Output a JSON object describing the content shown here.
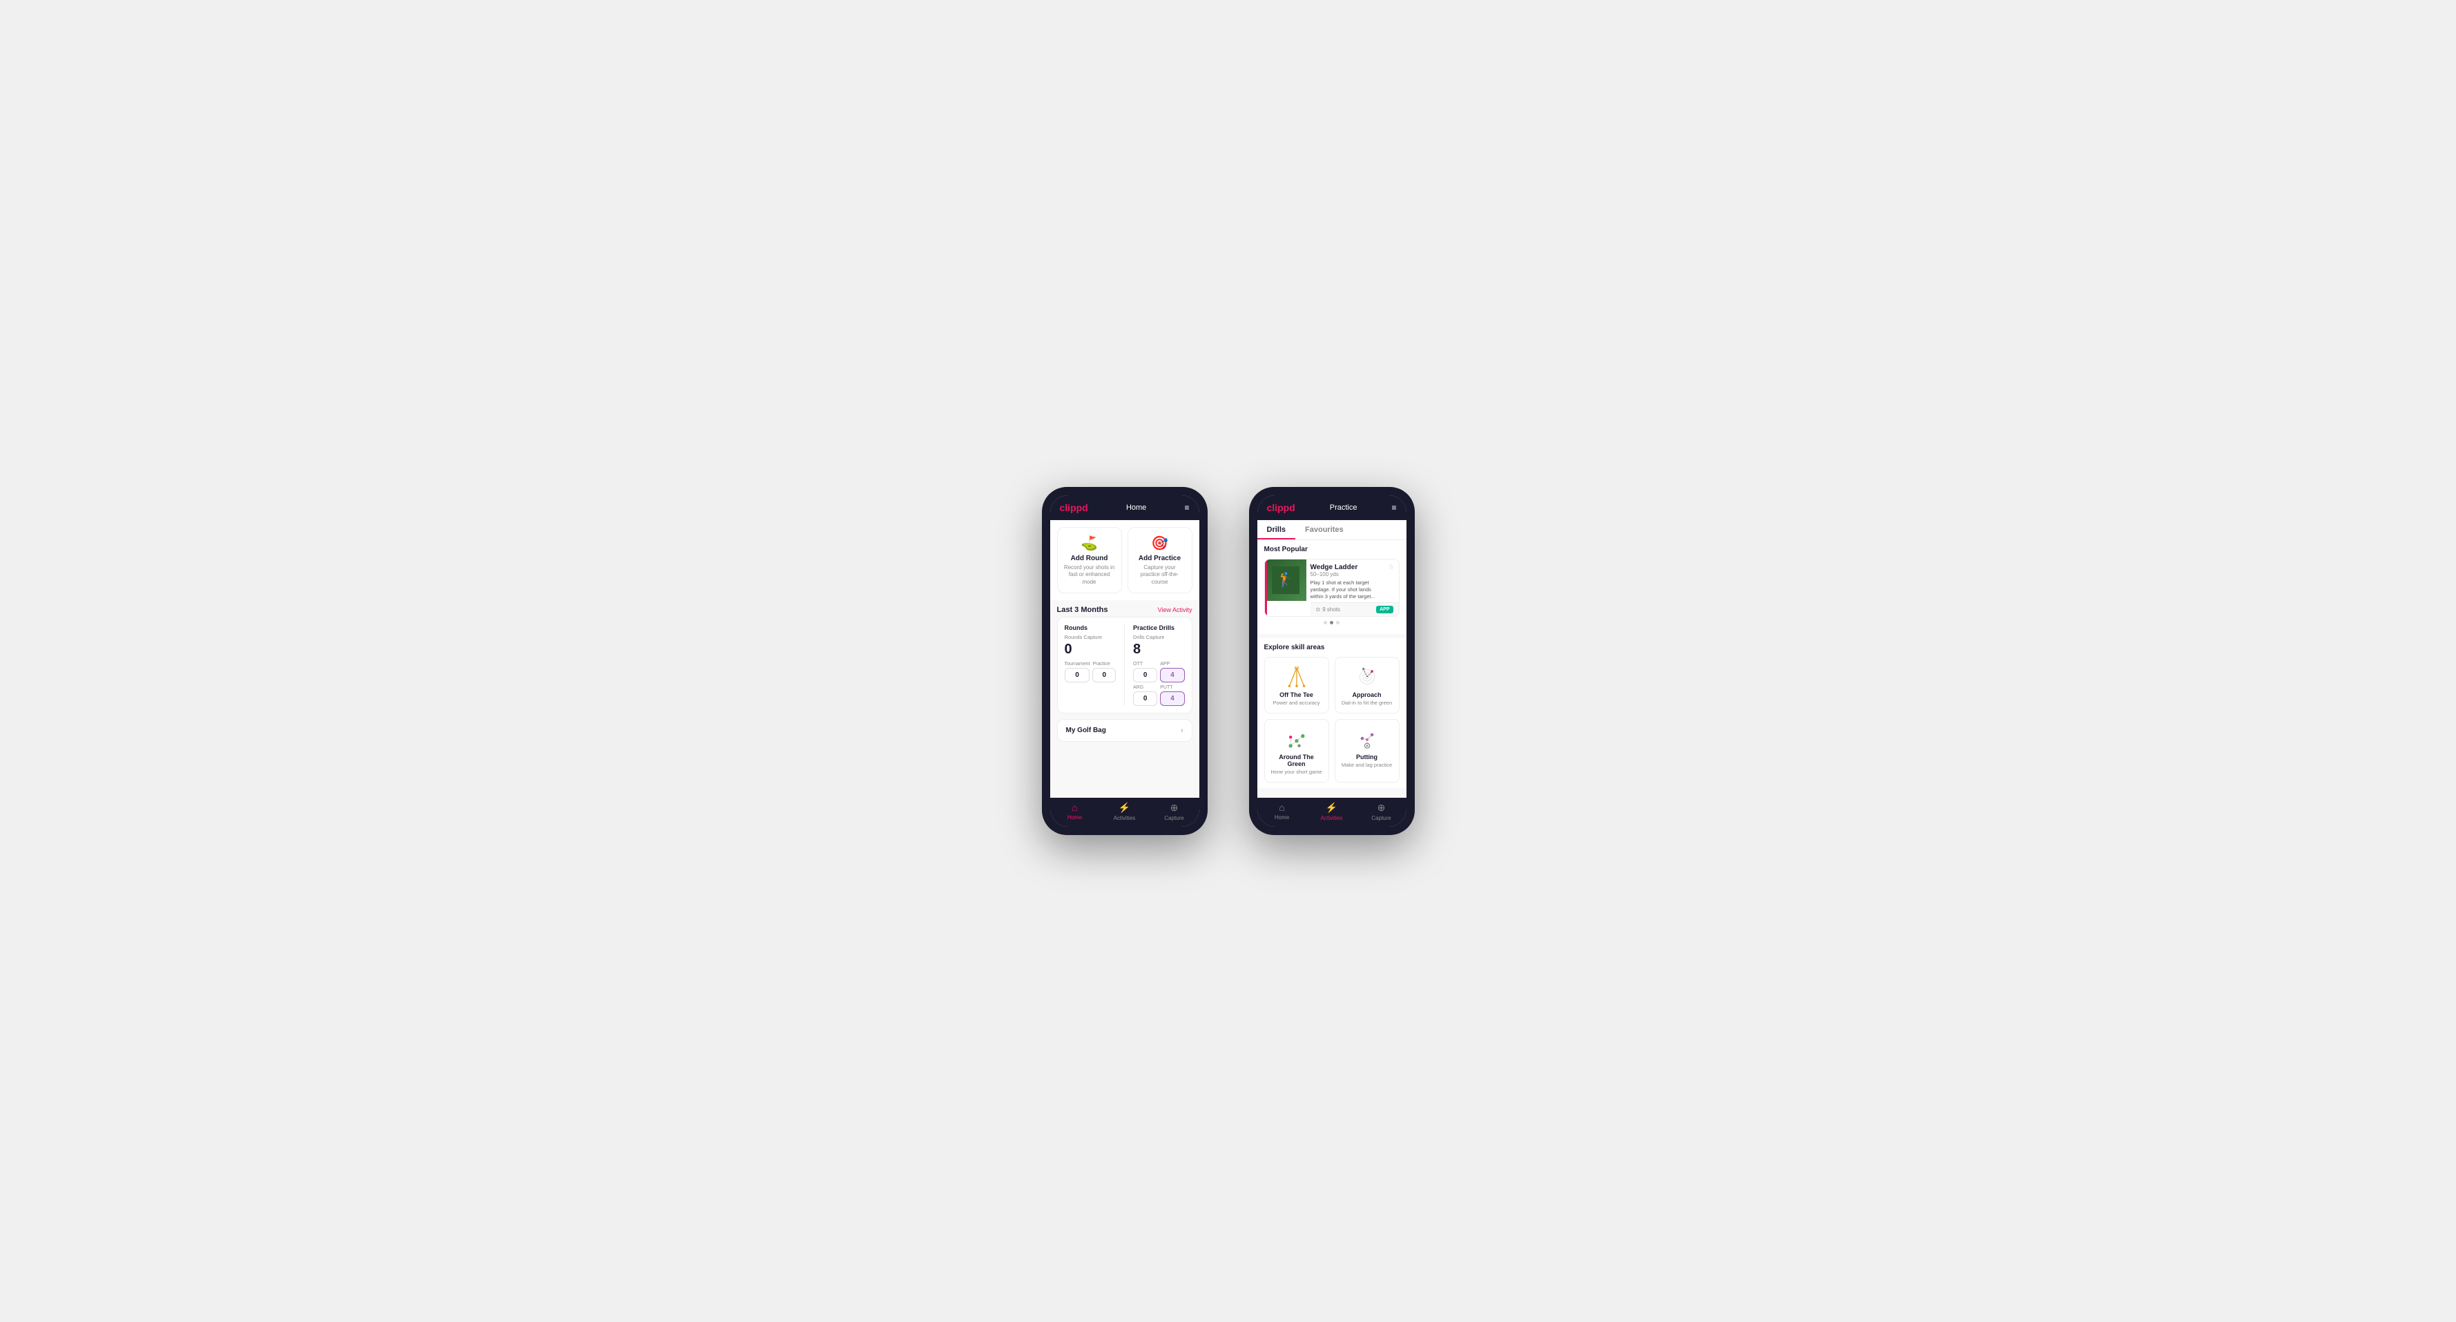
{
  "phone1": {
    "header": {
      "logo": "clippd",
      "title": "Home",
      "menu_icon": "≡"
    },
    "quick_actions": [
      {
        "id": "add-round",
        "icon": "⛳",
        "title": "Add Round",
        "desc": "Record your shots in fast or enhanced mode"
      },
      {
        "id": "add-practice",
        "icon": "🎯",
        "title": "Add Practice",
        "desc": "Capture your practice off-the-course"
      }
    ],
    "activity": {
      "section_title": "Last 3 Months",
      "section_link": "View Activity",
      "rounds": {
        "title": "Rounds",
        "capture_label": "Rounds Capture",
        "total": "0",
        "sub_items": [
          {
            "label": "Tournament",
            "value": "0"
          },
          {
            "label": "Practice",
            "value": "0"
          }
        ]
      },
      "practice": {
        "title": "Practice Drills",
        "capture_label": "Drills Capture",
        "total": "8",
        "sub_items": [
          {
            "label": "OTT",
            "value": "0"
          },
          {
            "label": "APP",
            "value": "4",
            "highlighted": true
          },
          {
            "label": "ARG",
            "value": "0"
          },
          {
            "label": "PUTT",
            "value": "4",
            "highlighted": true
          }
        ]
      }
    },
    "golf_bag": {
      "label": "My Golf Bag"
    },
    "bottom_nav": [
      {
        "id": "home",
        "icon": "🏠",
        "label": "Home",
        "active": true
      },
      {
        "id": "activities",
        "icon": "🏃",
        "label": "Activities",
        "active": false
      },
      {
        "id": "capture",
        "icon": "➕",
        "label": "Capture",
        "active": false
      }
    ]
  },
  "phone2": {
    "header": {
      "logo": "clippd",
      "title": "Practice",
      "menu_icon": "≡"
    },
    "tabs": [
      {
        "id": "drills",
        "label": "Drills",
        "active": true
      },
      {
        "id": "favourites",
        "label": "Favourites",
        "active": false
      }
    ],
    "most_popular": {
      "title": "Most Popular",
      "drill": {
        "name": "Wedge Ladder",
        "range": "50–100 yds",
        "desc": "Play 1 shot at each target yardage. If your shot lands within 3 yards of the target...",
        "shots": "9 shots",
        "badge": "APP"
      },
      "dots": [
        {
          "active": false
        },
        {
          "active": true
        },
        {
          "active": false
        }
      ]
    },
    "explore": {
      "title": "Explore skill areas",
      "skills": [
        {
          "id": "off-the-tee",
          "name": "Off The Tee",
          "desc": "Power and accuracy"
        },
        {
          "id": "approach",
          "name": "Approach",
          "desc": "Dial-in to hit the green"
        },
        {
          "id": "around-the-green",
          "name": "Around The Green",
          "desc": "Hone your short game"
        },
        {
          "id": "putting",
          "name": "Putting",
          "desc": "Make and lag practice"
        }
      ]
    },
    "bottom_nav": [
      {
        "id": "home",
        "icon": "🏠",
        "label": "Home",
        "active": false
      },
      {
        "id": "activities",
        "icon": "🏃",
        "label": "Activities",
        "active": true
      },
      {
        "id": "capture",
        "icon": "➕",
        "label": "Capture",
        "active": false
      }
    ]
  }
}
